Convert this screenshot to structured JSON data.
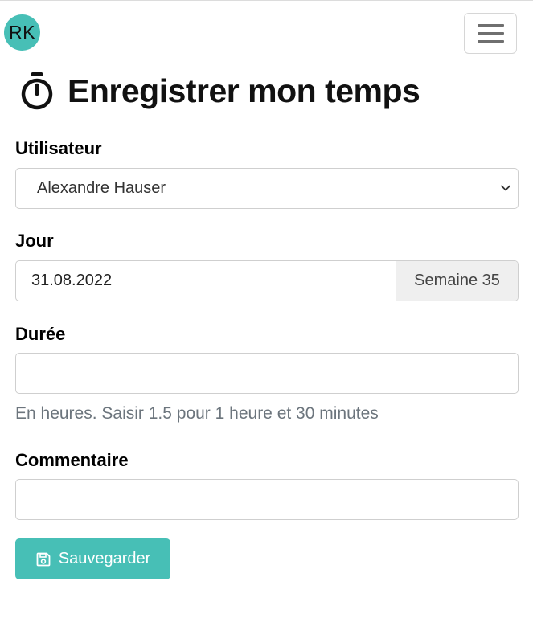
{
  "header": {
    "avatar_initials": "RK",
    "menu_icon": "hamburger-icon",
    "avatar_color": "#47bfb6"
  },
  "page": {
    "title": "Enregistrer mon temps",
    "title_icon": "stopwatch-icon"
  },
  "form": {
    "user": {
      "label": "Utilisateur",
      "value": "Alexandre Hauser"
    },
    "day": {
      "label": "Jour",
      "value": "31.08.2022",
      "week": "Semaine 35"
    },
    "duration": {
      "label": "Durée",
      "value": "",
      "help": "En heures. Saisir 1.5 pour 1 heure et 30 minutes"
    },
    "comment": {
      "label": "Commentaire",
      "value": ""
    },
    "save": {
      "label": "Sauvegarder",
      "icon": "floppy-disk-icon",
      "color": "#47bfb6"
    }
  }
}
